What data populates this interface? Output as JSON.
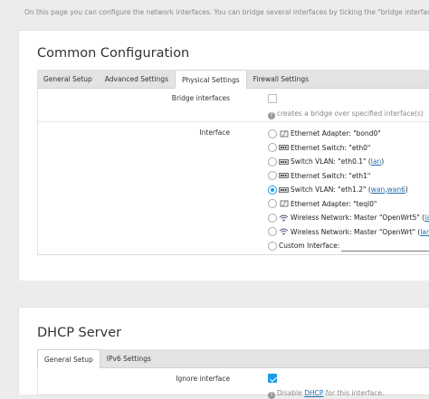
{
  "page": {
    "intro": "On this page you can configure the network interfaces. You can bridge several interfaces by ticking the \"bridge interfaces\""
  },
  "common": {
    "title": "Common Configuration",
    "tabs": [
      "General Setup",
      "Advanced Settings",
      "Physical Settings",
      "Firewall Settings"
    ],
    "active_tab": "Physical Settings",
    "bridge_label": "Bridge interfaces",
    "bridge_checked": false,
    "bridge_hint": "creates a bridge over specified interface(s)",
    "interface_label": "Interface",
    "interfaces": [
      {
        "icon": "ethernet-adapter-icon",
        "text": "Ethernet Adapter: \"bond0\"",
        "links": [],
        "selected": false
      },
      {
        "icon": "switch-icon",
        "text": "Ethernet Switch: \"eth0\"",
        "links": [],
        "selected": false
      },
      {
        "icon": "switch-icon",
        "text": "Switch VLAN: \"eth0.1\" (",
        "links": [
          "lan"
        ],
        "suffix": ")",
        "selected": false
      },
      {
        "icon": "switch-icon",
        "text": "Ethernet Switch: \"eth1\"",
        "links": [],
        "selected": false
      },
      {
        "icon": "switch-icon",
        "text": "Switch VLAN: \"eth1.2\" (",
        "links": [
          "wan",
          "wan6"
        ],
        "suffix": ")",
        "selected": true
      },
      {
        "icon": "ethernet-adapter-icon",
        "text": "Ethernet Adapter: \"teql0\"",
        "links": [],
        "selected": false
      },
      {
        "icon": "wireless-icon",
        "text": "Wireless Network: Master \"OpenWrt5\" (",
        "links": [
          "lan"
        ],
        "suffix": ")",
        "selected": false
      },
      {
        "icon": "wireless-icon",
        "text": "Wireless Network: Master \"OpenWrt\" (",
        "links": [
          "lan"
        ],
        "suffix": ")",
        "selected": false
      },
      {
        "icon": "",
        "text": "Custom Interface:",
        "links": [],
        "selected": false,
        "custom_value": ""
      }
    ]
  },
  "dhcp": {
    "title": "DHCP Server",
    "tabs": [
      "General Setup",
      "IPv6 Settings"
    ],
    "active_tab": "General Setup",
    "ignore_label": "Ignore interface",
    "ignore_checked": true,
    "hint_prefix": "Disable ",
    "hint_link": "DHCP",
    "hint_suffix": " for this interface."
  },
  "colors": {
    "accent": "#1c9ce8",
    "link": "#1f6fb2",
    "background": "#ececec"
  }
}
